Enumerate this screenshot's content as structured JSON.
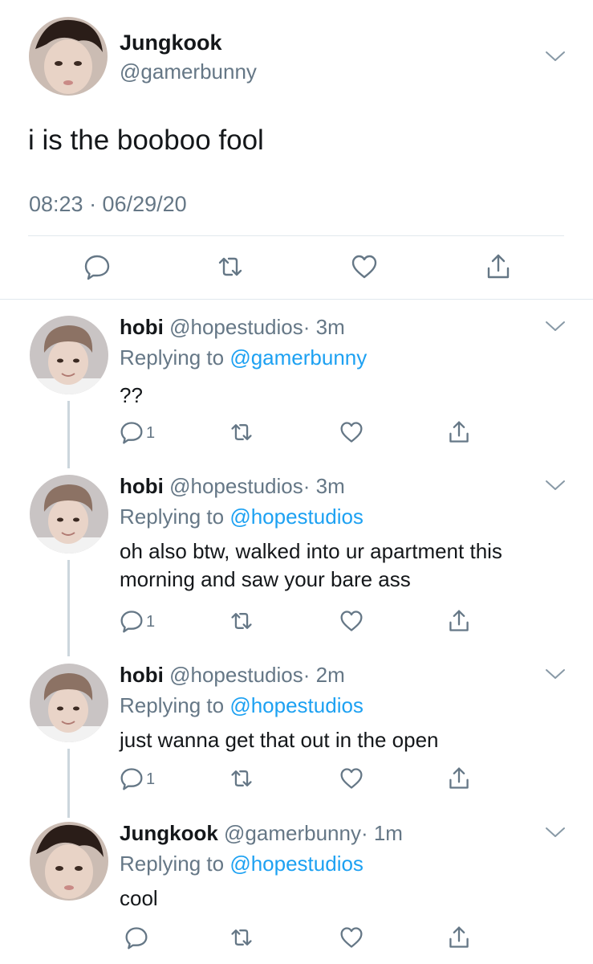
{
  "main_tweet": {
    "name": "Jungkook",
    "handle": "@gamerbunny",
    "text": "i is the booboo fool",
    "timestamp": "08:23 · 06/29/20",
    "actions": [
      "reply-icon",
      "retweet-icon",
      "like-icon",
      "share-icon"
    ]
  },
  "replies": [
    {
      "name": "hobi",
      "handle": "@hopestudios",
      "time": "· 3m",
      "replying_prefix": "Replying to ",
      "replying_to": "@gamerbunny",
      "text": "??",
      "reply_count": "1"
    },
    {
      "name": "hobi",
      "handle": "@hopestudios",
      "time": "· 3m",
      "replying_prefix": "Replying to ",
      "replying_to": "@hopestudios",
      "text": "oh also btw, walked into ur apartment this morning and saw your bare ass",
      "reply_count": "1"
    },
    {
      "name": "hobi",
      "handle": "@hopestudios",
      "time": "· 2m",
      "replying_prefix": "Replying to ",
      "replying_to": "@hopestudios",
      "text": "just wanna get that out in the open",
      "reply_count": "1"
    },
    {
      "name": "Jungkook",
      "handle": "@gamerbunny",
      "time": "· 1m",
      "replying_prefix": "Replying to ",
      "replying_to": "@hopestudios",
      "text": "cool",
      "reply_count": ""
    }
  ],
  "colors": {
    "link": "#1da1f2",
    "secondary_text": "#657786",
    "primary_text": "#14171a",
    "icon": "#657786",
    "thread_line": "#ccd6dd"
  }
}
